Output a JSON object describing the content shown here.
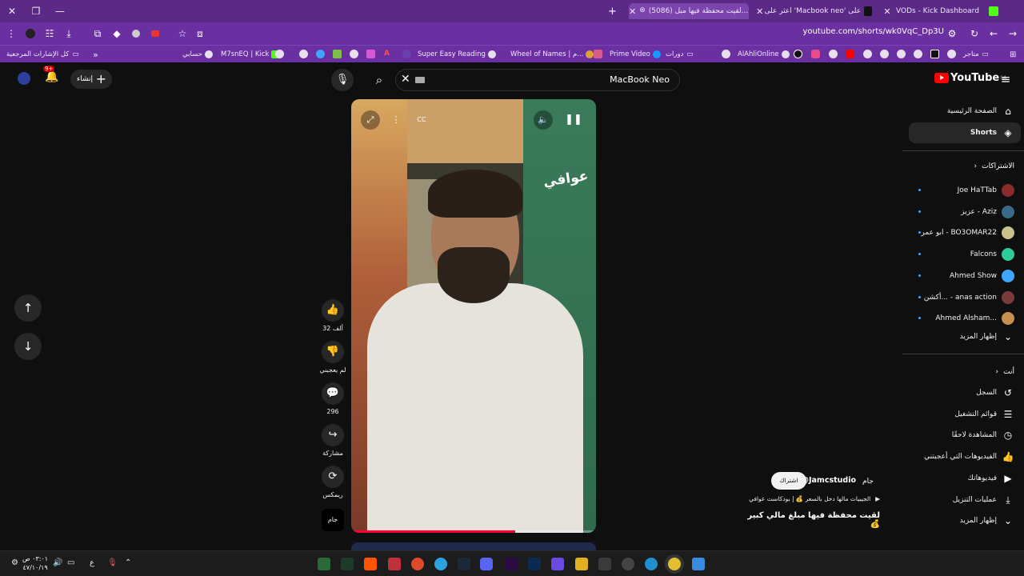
{
  "browser": {
    "tabs": [
      {
        "title": "VODs - Kick Dashboard",
        "color": "#53fc18"
      },
      {
        "title": "اعثر على 'Macbook neo' على",
        "color": "#111111"
      },
      {
        "title": "(5086) لقيت محفظة فيها مبل...",
        "color": "#ff0000"
      }
    ],
    "new_tab": "+",
    "url": "youtube.com/shorts/wk0VqC_Dp3U",
    "bookmarks": [
      {
        "label": "كل الإشارات المرجعية"
      },
      {
        "label": "حسابي"
      },
      {
        "label": "M7snEQ | Kick"
      },
      {
        "label": "Super Easy Reading"
      },
      {
        "label": "Wheel of Names | م..."
      },
      {
        "label": "Prime Video"
      },
      {
        "label": "دورات"
      },
      {
        "label": "AlAhliOnline"
      },
      {
        "label": "متاجر"
      }
    ],
    "bookmarks_more": "»"
  },
  "youtube": {
    "logo": "YouTube",
    "region": "SA",
    "search_query": "MacBook Neo",
    "create_label": "إنشاء",
    "notif_badge": "9+",
    "sidebar": {
      "main": [
        {
          "label": "الصفحة الرئيسية",
          "icon": "home-icon",
          "glyph": "⌂"
        },
        {
          "label": "Shorts",
          "icon": "shorts-icon",
          "glyph": "◈",
          "active": true
        }
      ],
      "subs_header": "الاشتراكات",
      "subs": [
        {
          "label": "Joe HaTTab",
          "color": "#8b2c2c"
        },
        {
          "label": "عزيز - Aziz",
          "color": "#3a6a8a"
        },
        {
          "label": "ابو عمر - BO3OMAR22",
          "color": "#c9c28a"
        },
        {
          "label": "Falcons",
          "color": "#2ecc9a"
        },
        {
          "label": "Ahmed Show",
          "color": "#3ea6ff"
        },
        {
          "label": "أكشن... - anas action",
          "color": "#7a3a3a"
        },
        {
          "label": "Ahmed Alsham...",
          "color": "#c89050"
        }
      ],
      "subs_more": "إظهار المزيد",
      "you_header": "أنت",
      "you": [
        {
          "label": "السجل",
          "glyph": "↺"
        },
        {
          "label": "قوائم التشغيل",
          "glyph": "☰"
        },
        {
          "label": "المشاهدة لاحقًا",
          "glyph": "◷"
        },
        {
          "label": "الفيديوهات التي أعجبتني",
          "glyph": "👍"
        },
        {
          "label": "فيديوهاتك",
          "glyph": "▶"
        },
        {
          "label": "عمليات التنزيل",
          "glyph": "⤓"
        },
        {
          "label": "إظهار المزيد",
          "glyph": "⌄"
        }
      ]
    },
    "short": {
      "watermark": "عوافي",
      "progress": 0.67,
      "actions": [
        {
          "name": "like",
          "glyph": "👍",
          "label": "32 ألف"
        },
        {
          "name": "dislike",
          "glyph": "👎",
          "label": "لم يعجبني"
        },
        {
          "name": "comments",
          "glyph": "💬",
          "label": "296"
        },
        {
          "name": "share",
          "glyph": "↪",
          "label": "مشاركة"
        },
        {
          "name": "remix",
          "glyph": "⟳",
          "label": "ريمكس"
        }
      ],
      "channel": "@Jamcstudio",
      "channel_logo": "جام",
      "subscribe": "اشتراك",
      "tagline": "الجيبيات مالها دخل بالسعر 💰 | بودكاست عوافي",
      "title": "لقيت محفظة فيها مبلغ مالي كبير 💰"
    }
  },
  "taskbar": {
    "time": "٠٣:٠١ ص",
    "date": "٤٧/١٠/١٩",
    "lang": "ع"
  }
}
